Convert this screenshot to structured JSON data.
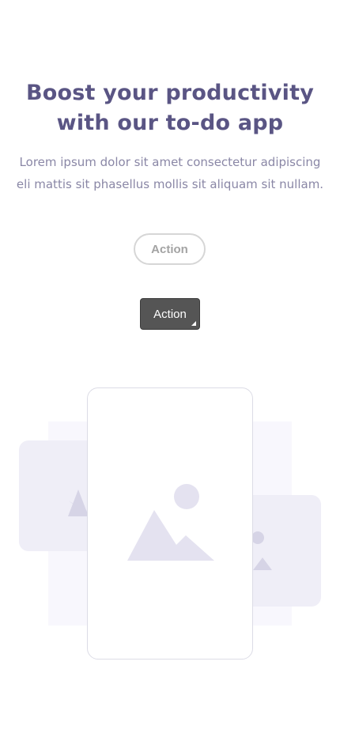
{
  "hero": {
    "headline_line1": "Boost your productivity",
    "headline_line2": "with our to-do app",
    "body_line1": "Lorem ipsum dolor sit amet consectetur adipiscing",
    "body_line2": "eli mattis sit phasellus mollis sit aliquam sit nullam."
  },
  "actions": {
    "outline_button_label": "Action",
    "filled_button_label": "Action"
  },
  "illustration": {
    "icons": [
      "image-placeholder-icon",
      "image-placeholder-icon",
      "image-placeholder-icon"
    ],
    "colors": {
      "accent_text": "#5a5584",
      "muted_text": "#8a87a6",
      "placeholder_fill": "#e4e2f0",
      "card_fill": "#efeef7",
      "panel_fill": "#f8f7fd"
    }
  }
}
